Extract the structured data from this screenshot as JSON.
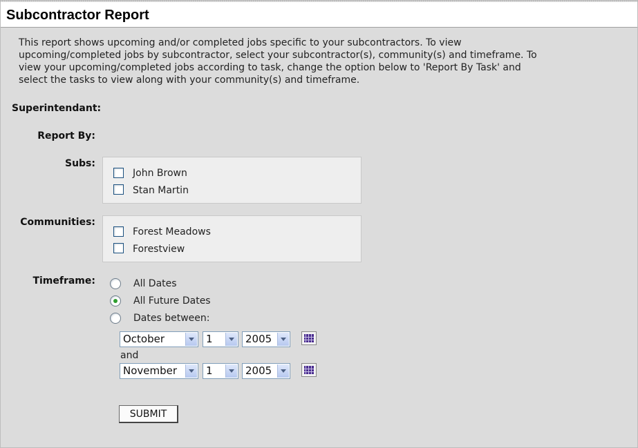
{
  "page": {
    "title": "Subcontractor Report",
    "intro": "This report shows upcoming and/or completed jobs specific to your subcontractors. To view upcoming/completed jobs by subcontractor, select your subcontractor(s), community(s) and timeframe. To view your upcoming/completed jobs according to task, change the option below to 'Report By Task' and select the tasks to view along with your community(s) and timeframe."
  },
  "form": {
    "superintendant_label": "Superintendant:",
    "report_by_label": "Report By:",
    "subs_label": "Subs:",
    "subs": [
      {
        "label": "John Brown",
        "checked": false
      },
      {
        "label": "Stan Martin",
        "checked": false
      }
    ],
    "communities_label": "Communities:",
    "communities": [
      {
        "label": "Forest Meadows",
        "checked": false
      },
      {
        "label": "Forestview",
        "checked": false
      }
    ],
    "timeframe_label": "Timeframe:",
    "timeframe_options": [
      {
        "label": "All Dates",
        "selected": false
      },
      {
        "label": "All Future Dates",
        "selected": true
      },
      {
        "label": "Dates between:",
        "selected": false
      }
    ],
    "start_date": {
      "month": "October",
      "day": "1",
      "year": "2005"
    },
    "and_label": "and",
    "end_date": {
      "month": "November",
      "day": "1",
      "year": "2005"
    },
    "submit_label": "SUBMIT"
  },
  "colors": {
    "background": "#dcdcdc",
    "box_background": "#eeeeee",
    "radio_selected": "#2f9e2f",
    "calendar_icon": "#4b2d8f"
  }
}
